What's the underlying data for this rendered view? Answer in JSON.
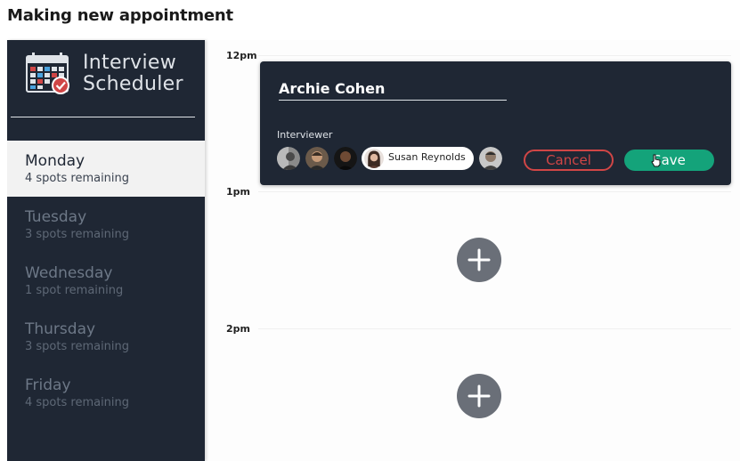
{
  "page": {
    "heading": "Making new appointment"
  },
  "sidebar": {
    "logo_line1": "Interview",
    "logo_line2": "Scheduler",
    "logo_icon": "calendar-icon",
    "days": [
      {
        "name": "Monday",
        "spots": "4 spots remaining",
        "selected": true
      },
      {
        "name": "Tuesday",
        "spots": "3 spots remaining",
        "selected": false
      },
      {
        "name": "Wednesday",
        "spots": "1 spot remaining",
        "selected": false
      },
      {
        "name": "Thursday",
        "spots": "3 spots remaining",
        "selected": false
      },
      {
        "name": "Friday",
        "spots": "4 spots remaining",
        "selected": false
      }
    ]
  },
  "schedule": {
    "times": [
      "12pm",
      "1pm",
      "2pm"
    ],
    "form": {
      "student_name": "Archie Cohen",
      "interviewer_label": "Interviewer",
      "selected_interviewer": "Susan Reynolds",
      "cancel_label": "Cancel",
      "save_label": "Save"
    },
    "add_icon": "plus-icon"
  },
  "colors": {
    "sidebar_bg": "#1f2734",
    "cancel": "#d04646",
    "save": "#14a37a",
    "add_button": "#6a6f78"
  }
}
